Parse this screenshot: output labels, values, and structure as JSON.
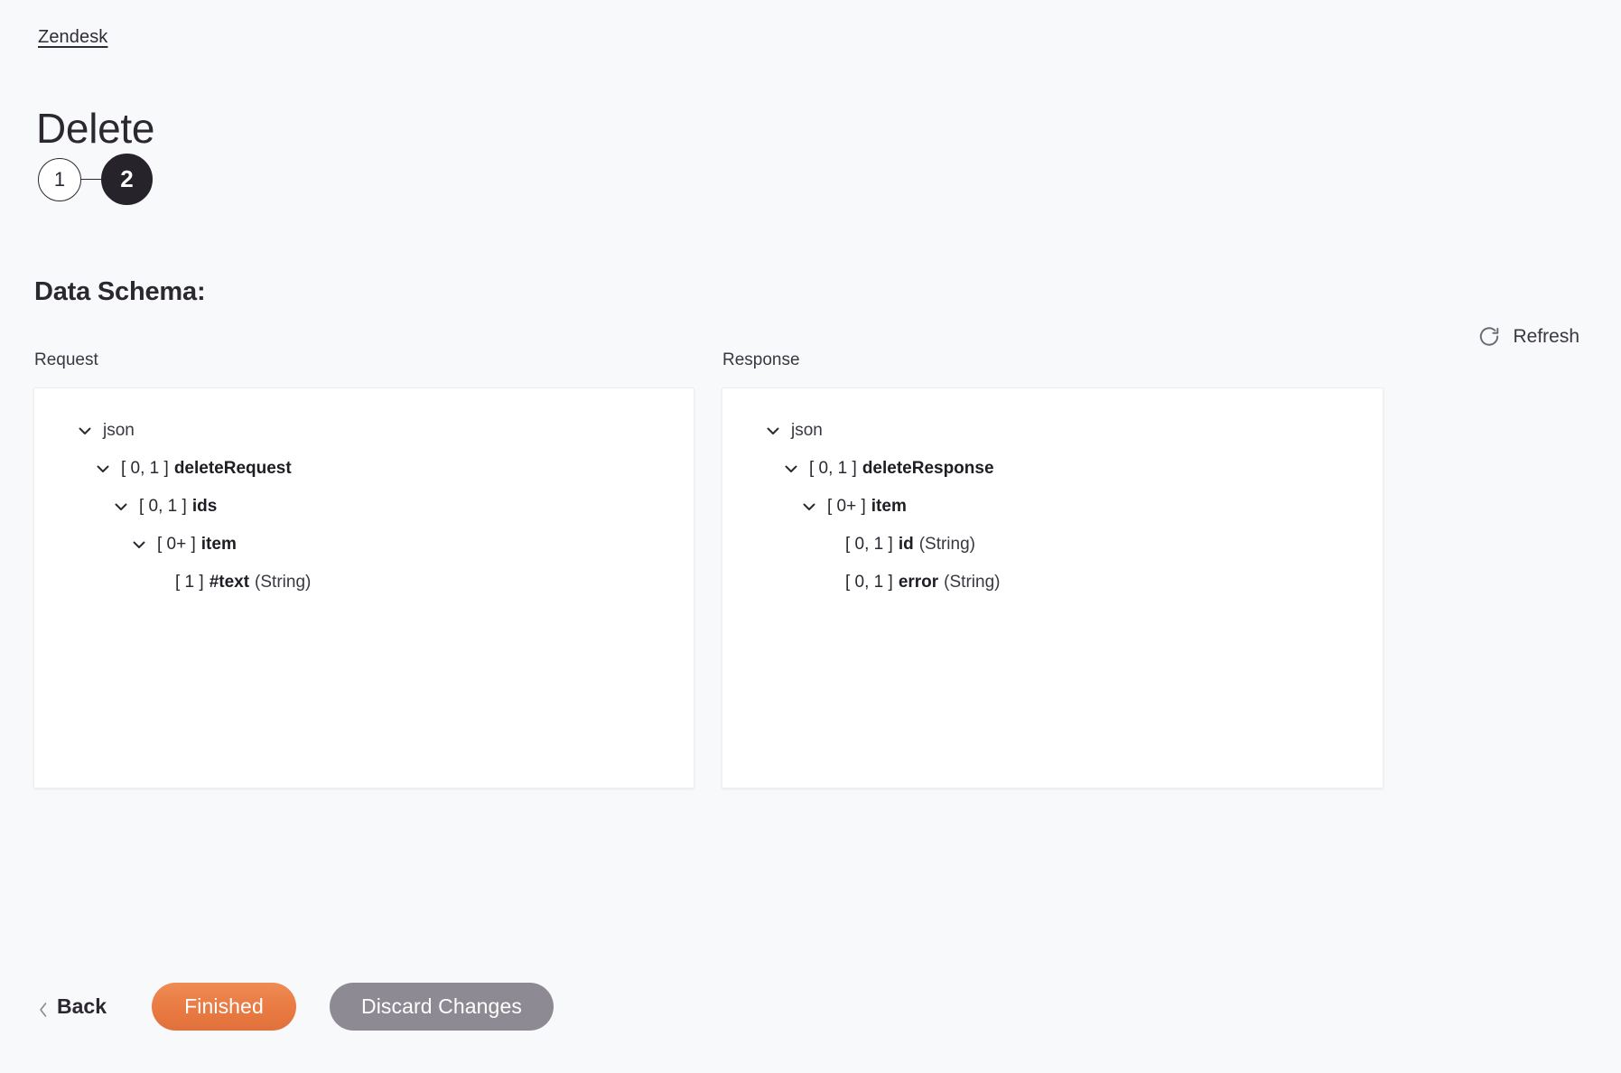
{
  "breadcrumb": {
    "label": "Zendesk"
  },
  "header": {
    "title": "Delete"
  },
  "stepper": {
    "steps": [
      {
        "label": "1",
        "state": "inactive"
      },
      {
        "label": "2",
        "state": "active"
      }
    ]
  },
  "section": {
    "heading": "Data Schema:"
  },
  "toolbar": {
    "refresh_label": "Refresh",
    "refresh_icon": "refresh-icon"
  },
  "columns": {
    "request": {
      "label": "Request",
      "tree": [
        {
          "depth": 0,
          "chevron": "chevron-down-icon",
          "cardinality": "",
          "name": "json",
          "type": "",
          "plain": true
        },
        {
          "depth": 1,
          "chevron": "chevron-down-icon",
          "cardinality": "[ 0, 1 ]",
          "name": "deleteRequest",
          "type": ""
        },
        {
          "depth": 2,
          "chevron": "chevron-down-icon",
          "cardinality": "[ 0, 1 ]",
          "name": "ids",
          "type": ""
        },
        {
          "depth": 3,
          "chevron": "chevron-down-icon",
          "cardinality": "[ 0+ ]",
          "name": "item",
          "type": ""
        },
        {
          "depth": 4,
          "chevron": "",
          "cardinality": "[ 1 ]",
          "name": "#text",
          "type": "(String)"
        }
      ]
    },
    "response": {
      "label": "Response",
      "tree": [
        {
          "depth": 0,
          "chevron": "chevron-down-icon",
          "cardinality": "",
          "name": "json",
          "type": "",
          "plain": true
        },
        {
          "depth": 1,
          "chevron": "chevron-down-icon",
          "cardinality": "[ 0, 1 ]",
          "name": "deleteResponse",
          "type": ""
        },
        {
          "depth": 2,
          "chevron": "chevron-down-icon",
          "cardinality": "[ 0+ ]",
          "name": "item",
          "type": ""
        },
        {
          "depth": 3,
          "chevron": "",
          "cardinality": "[ 0, 1 ]",
          "name": "id",
          "type": "(String)"
        },
        {
          "depth": 3,
          "chevron": "",
          "cardinality": "[ 0, 1 ]",
          "name": "error",
          "type": "(String)"
        }
      ]
    }
  },
  "footer": {
    "back_label": "Back",
    "back_icon": "chevron-left-icon",
    "finished_label": "Finished",
    "discard_label": "Discard Changes"
  },
  "colors": {
    "page_background": "#f8f9fb",
    "panel_background": "#ffffff",
    "accent_orange": "#e87a42",
    "neutral_gray": "#8d8a93",
    "step_active": "#26232b",
    "text_primary": "#2b2830"
  }
}
